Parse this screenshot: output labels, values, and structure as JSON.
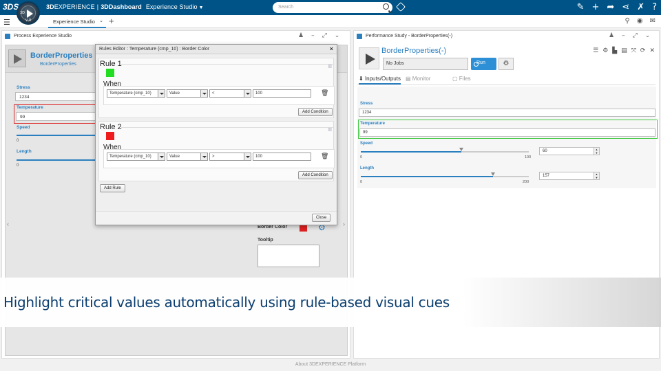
{
  "topbar": {
    "logo": "3DS",
    "compass_labels": [
      "3D",
      "V,R"
    ],
    "brand_prefix": "3D",
    "brand_rest": "EXPERIENCE",
    "brand_sep": "|",
    "app_name": "3DDashboard",
    "studio": "Experience Studio",
    "search_placeholder": "Search",
    "icons": [
      "pencil-icon",
      "plus-icon",
      "share-icon",
      "network-icon",
      "tools-icon",
      "help-icon"
    ]
  },
  "tabbar": {
    "tab_label": "Experience Studio",
    "add_label": "+"
  },
  "left_panel": {
    "title": "Process Experience Studio",
    "component_name": "BorderProperties (-)",
    "component_sub": "BorderProperties",
    "fields": [
      {
        "label": "Stress",
        "value": "1234"
      },
      {
        "label": "Temperature",
        "value": "99"
      },
      {
        "label": "Speed",
        "min": "0"
      },
      {
        "label": "Length",
        "min": "0"
      }
    ],
    "border_color_label": "Border Color",
    "tooltip_label": "Tooltip"
  },
  "dialog": {
    "title": "Rules Editor : Temperature (cmp_10) : Border Color",
    "close_x": "×",
    "rules": [
      {
        "title": "Rule 1",
        "color": "#22dd22",
        "when": "When",
        "condition": {
          "field": "Temperature (cmp_10)",
          "type": "Value",
          "op": "<",
          "value": "100"
        },
        "add_condition": "Add Condition"
      },
      {
        "title": "Rule 2",
        "color": "#ee1c1c",
        "when": "When",
        "condition": {
          "field": "Temperature (cmp_10)",
          "type": "Value",
          "op": ">",
          "value": "100"
        },
        "add_condition": "Add Condition"
      }
    ],
    "add_rule": "Add Rule",
    "close": "Close"
  },
  "right_panel": {
    "title": "Performance Study - BorderProperties(-)",
    "component_name": "BorderProperties(-)",
    "jobs": "No Jobs",
    "run": "Run",
    "tabs": [
      {
        "label": "Inputs/Outputs",
        "active": true
      },
      {
        "label": "Monitor",
        "active": false
      },
      {
        "label": "Files",
        "active": false
      }
    ],
    "stress": {
      "label": "Stress",
      "value": "1234"
    },
    "temperature": {
      "label": "Temperature",
      "value": "99"
    },
    "speed": {
      "label": "Speed",
      "min": "0",
      "max": "100",
      "value": "60",
      "fraction": 0.6
    },
    "length": {
      "label": "Length",
      "min": "0",
      "max": "200",
      "value": "157",
      "fraction": 0.785
    }
  },
  "caption": "Highlight critical values automatically using rule-based visual cues",
  "footer": "About 3DEXPERIENCE Platform"
}
